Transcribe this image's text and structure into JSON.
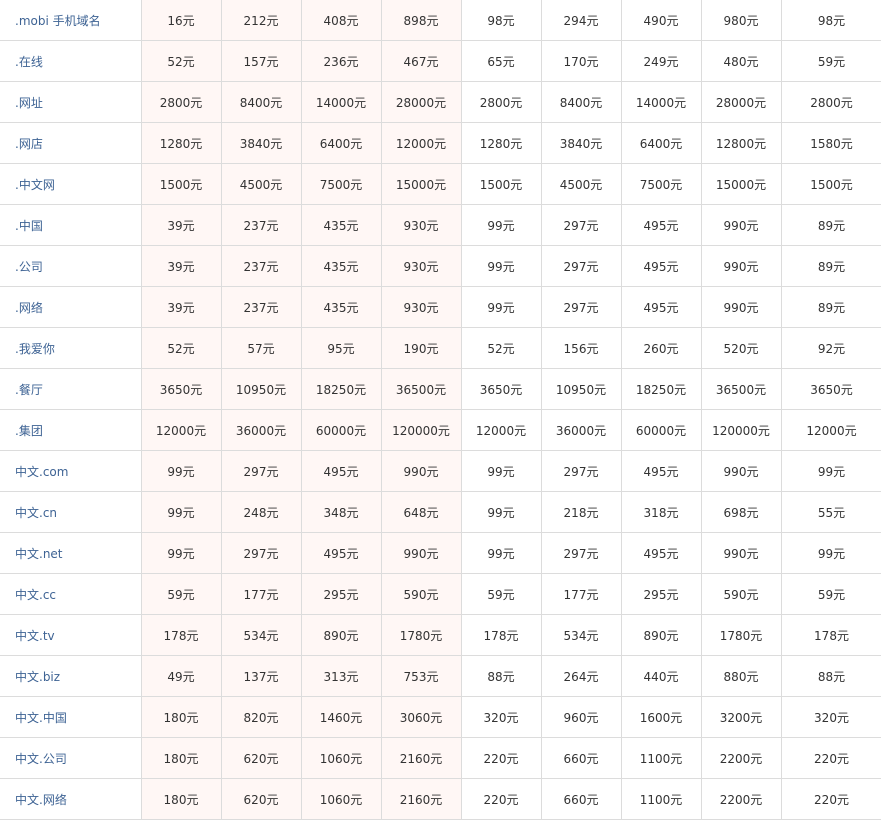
{
  "rows": [
    {
      "name": ".mobi 手机域名",
      "prices": [
        "16元",
        "212元",
        "408元",
        "898元",
        "98元",
        "294元",
        "490元",
        "980元",
        "98元"
      ]
    },
    {
      "name": ".在线",
      "prices": [
        "52元",
        "157元",
        "236元",
        "467元",
        "65元",
        "170元",
        "249元",
        "480元",
        "59元"
      ]
    },
    {
      "name": ".网址",
      "prices": [
        "2800元",
        "8400元",
        "14000元",
        "28000元",
        "2800元",
        "8400元",
        "14000元",
        "28000元",
        "2800元"
      ]
    },
    {
      "name": ".网店",
      "prices": [
        "1280元",
        "3840元",
        "6400元",
        "12000元",
        "1280元",
        "3840元",
        "6400元",
        "12800元",
        "1580元"
      ]
    },
    {
      "name": ".中文网",
      "prices": [
        "1500元",
        "4500元",
        "7500元",
        "15000元",
        "1500元",
        "4500元",
        "7500元",
        "15000元",
        "1500元"
      ]
    },
    {
      "name": ".中国",
      "prices": [
        "39元",
        "237元",
        "435元",
        "930元",
        "99元",
        "297元",
        "495元",
        "990元",
        "89元"
      ]
    },
    {
      "name": ".公司",
      "prices": [
        "39元",
        "237元",
        "435元",
        "930元",
        "99元",
        "297元",
        "495元",
        "990元",
        "89元"
      ]
    },
    {
      "name": ".网络",
      "prices": [
        "39元",
        "237元",
        "435元",
        "930元",
        "99元",
        "297元",
        "495元",
        "990元",
        "89元"
      ]
    },
    {
      "name": ".我爱你",
      "prices": [
        "52元",
        "57元",
        "95元",
        "190元",
        "52元",
        "156元",
        "260元",
        "520元",
        "92元"
      ]
    },
    {
      "name": ".餐厅",
      "prices": [
        "3650元",
        "10950元",
        "18250元",
        "36500元",
        "3650元",
        "10950元",
        "18250元",
        "36500元",
        "3650元"
      ]
    },
    {
      "name": ".集团",
      "prices": [
        "12000元",
        "36000元",
        "60000元",
        "120000元",
        "12000元",
        "36000元",
        "60000元",
        "120000元",
        "12000元"
      ]
    },
    {
      "name": "中文.com",
      "prices": [
        "99元",
        "297元",
        "495元",
        "990元",
        "99元",
        "297元",
        "495元",
        "990元",
        "99元"
      ]
    },
    {
      "name": "中文.cn",
      "prices": [
        "99元",
        "248元",
        "348元",
        "648元",
        "99元",
        "218元",
        "318元",
        "698元",
        "55元"
      ]
    },
    {
      "name": "中文.net",
      "prices": [
        "99元",
        "297元",
        "495元",
        "990元",
        "99元",
        "297元",
        "495元",
        "990元",
        "99元"
      ]
    },
    {
      "name": "中文.cc",
      "prices": [
        "59元",
        "177元",
        "295元",
        "590元",
        "59元",
        "177元",
        "295元",
        "590元",
        "59元"
      ]
    },
    {
      "name": "中文.tv",
      "prices": [
        "178元",
        "534元",
        "890元",
        "1780元",
        "178元",
        "534元",
        "890元",
        "1780元",
        "178元"
      ]
    },
    {
      "name": "中文.biz",
      "prices": [
        "49元",
        "137元",
        "313元",
        "753元",
        "88元",
        "264元",
        "440元",
        "880元",
        "88元"
      ]
    },
    {
      "name": "中文.中国",
      "prices": [
        "180元",
        "820元",
        "1460元",
        "3060元",
        "320元",
        "960元",
        "1600元",
        "3200元",
        "320元"
      ]
    },
    {
      "name": "中文.公司",
      "prices": [
        "180元",
        "620元",
        "1060元",
        "2160元",
        "220元",
        "660元",
        "1100元",
        "2200元",
        "220元"
      ]
    },
    {
      "name": "中文.网络",
      "prices": [
        "180元",
        "620元",
        "1060元",
        "2160元",
        "220元",
        "660元",
        "1100元",
        "2200元",
        "220元"
      ]
    }
  ],
  "colors": {
    "name_text": "#3e6394",
    "price_text": "#333333",
    "pink_cell_bg": "#fff7f5",
    "border": "#dcdcdc"
  }
}
